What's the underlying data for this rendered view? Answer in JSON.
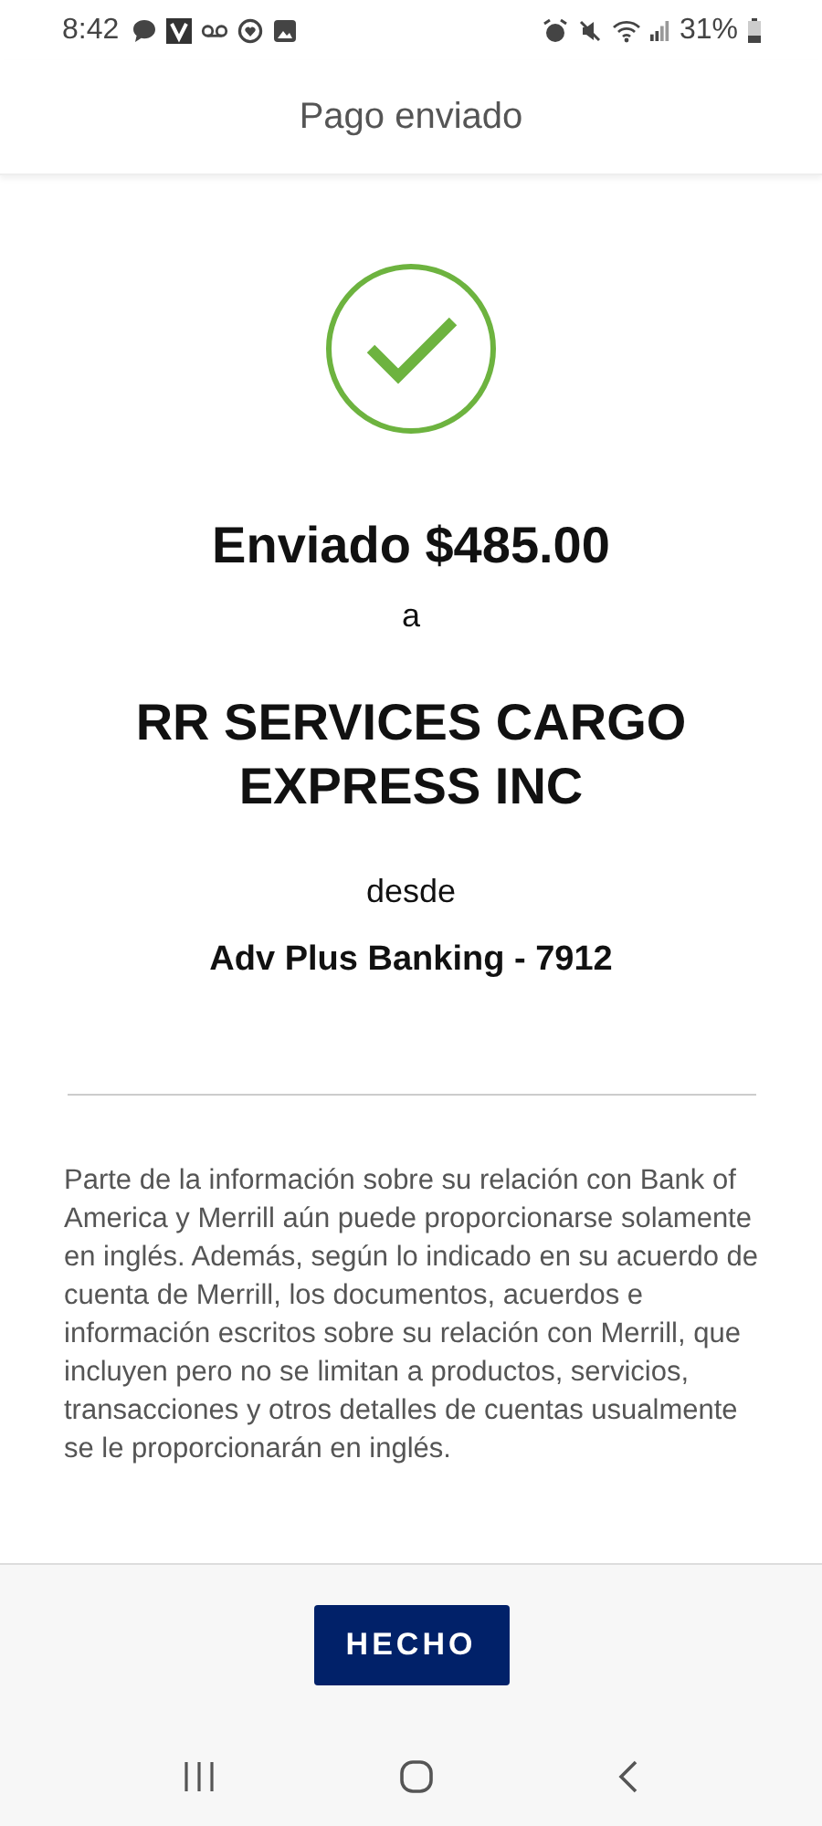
{
  "status_bar": {
    "time": "8:42",
    "battery": "31%"
  },
  "header": {
    "title": "Pago enviado"
  },
  "confirmation": {
    "amount_line": "Enviado $485.00",
    "connector_to": "a",
    "payee": "RR SERVICES CARGO EXPRESS INC",
    "connector_from": "desde",
    "account": "Adv Plus Banking - 7912"
  },
  "disclaimer": "Parte de la información sobre su relación con Bank of America y Merrill aún puede proporcionarse solamente en inglés. Además, según lo indicado en su acuerdo de cuenta de Merrill, los documentos, acuerdos e información escritos sobre su relación con Merrill, que incluyen pero no se limitan a productos, servicios, transacciones y otros detalles de cuentas usualmente se le proporcionarán en inglés.",
  "footer": {
    "button": "HECHO"
  }
}
